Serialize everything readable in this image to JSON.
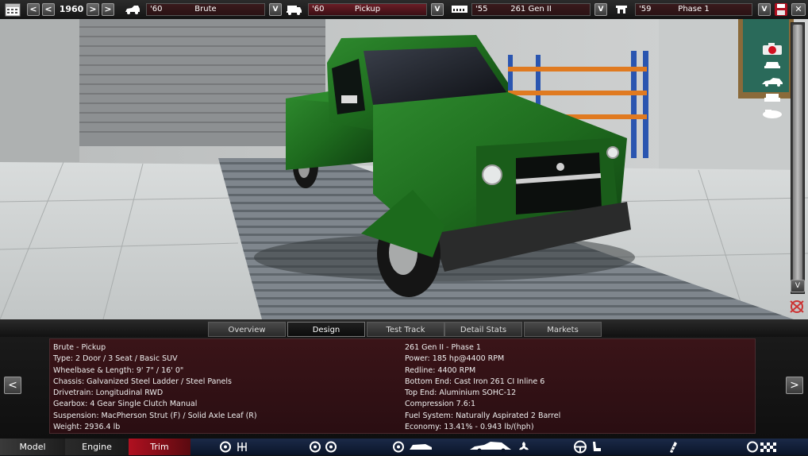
{
  "toolbar": {
    "year": "1960",
    "selectors": [
      {
        "year": "'60",
        "name": "Brute",
        "icon": "car-family-icon"
      },
      {
        "year": "'60",
        "name": "Pickup",
        "icon": "car-variant-icon"
      },
      {
        "year": "'55",
        "name": "261 Gen II",
        "icon": "engine-family-icon"
      },
      {
        "year": "'59",
        "name": "Phase 1",
        "icon": "engine-variant-icon"
      }
    ],
    "arrow_left": "<",
    "arrow_right": ">",
    "dropdown": "V",
    "close": "✕"
  },
  "scrollbar": {
    "down": "V"
  },
  "tabs": [
    {
      "label": "Overview",
      "active": false
    },
    {
      "label": "Design",
      "active": true
    },
    {
      "label": "Test Track",
      "active": false
    },
    {
      "label": "Detail Stats",
      "active": false
    },
    {
      "label": "Markets",
      "active": false
    }
  ],
  "info": {
    "left": [
      "Brute - Pickup",
      "Type: 2 Door / 3 Seat / Basic SUV",
      "Wheelbase & Length: 9' 7\" / 16' 0\"",
      "Chassis: Galvanized Steel Ladder / Steel Panels",
      "Drivetrain: Longitudinal RWD",
      "Gearbox: 4 Gear Single Clutch Manual",
      "Suspension: MacPherson Strut (F) / Solid Axle Leaf (R)",
      "Weight: 2936.4 lb"
    ],
    "right": [
      "261 Gen II - Phase 1",
      "Power: 185 hp@4400 RPM",
      "Redline: 4400 RPM",
      "Bottom End: Cast Iron 261 CI Inline 6",
      "Top End: Aluminium SOHC-12",
      "Compression 7.6:1",
      "Fuel System: Naturally Aspirated 2 Barrel",
      "Economy: 13.41% - 0.943 lb/(hph)"
    ],
    "prev": "<",
    "next": ">"
  },
  "bottom_nav": {
    "model": "Model",
    "engine": "Engine",
    "trim": "Trim"
  },
  "colors": {
    "car_body": "#1e6b1e",
    "accent_red": "#b01020",
    "nav_blue": "#0a1428"
  }
}
